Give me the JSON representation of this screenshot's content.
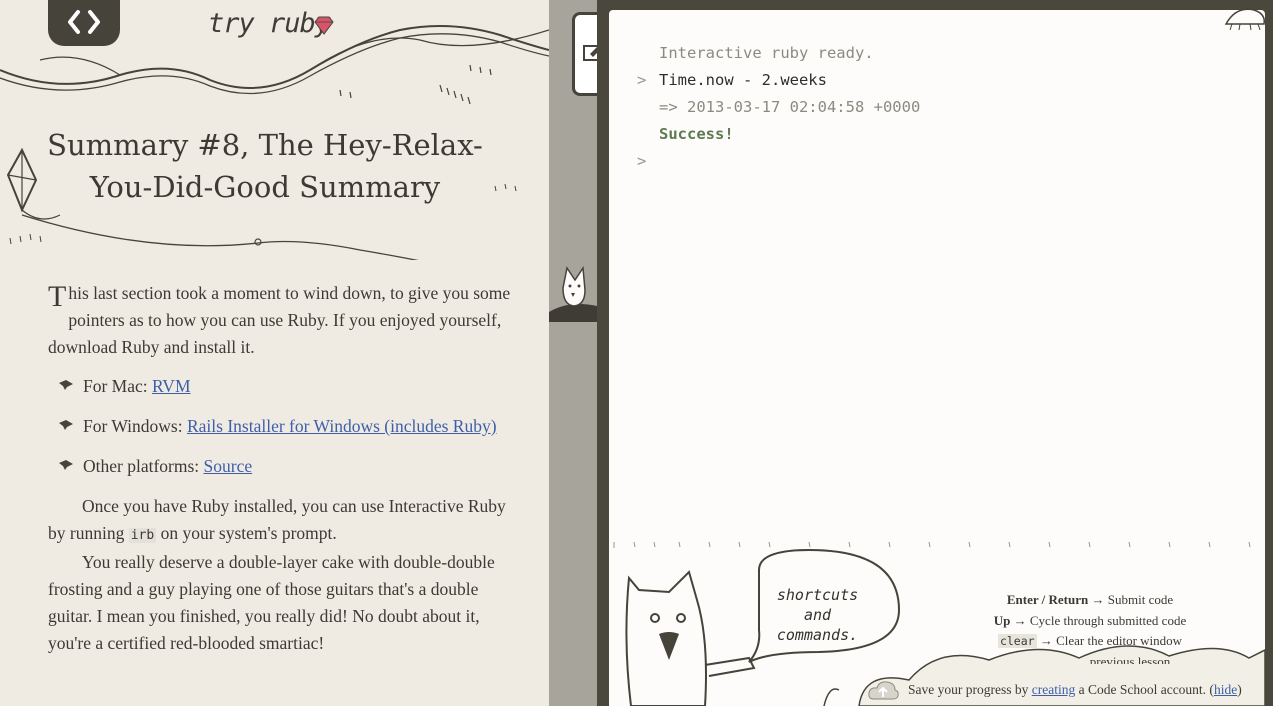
{
  "header": {
    "toggle_icon": "code-brackets-icon",
    "logo_text": "try ruby",
    "logo_icon": "ruby-gem-icon"
  },
  "lesson": {
    "title": "Summary #8, The Hey-Relax-You-Did-Good Summary",
    "intro_dropcap": "T",
    "intro_rest": "his last section took a moment to wind down, to give you some pointers as to how you can use Ruby. If you enjoyed yourself, download Ruby and install it.",
    "platforms": [
      {
        "label": "For Mac: ",
        "link": "RVM"
      },
      {
        "label": "For Windows: ",
        "link": "Rails Installer for Windows (includes Ruby)"
      },
      {
        "label": "Other platforms: ",
        "link": "Source"
      }
    ],
    "para2_pre": "Once you have Ruby installed, you can use Interactive Ruby by running ",
    "para2_code": "irb",
    "para2_post": " on your system's prompt.",
    "para3": "You really deserve a double-layer cake with double-double frosting and a guy playing one of those guitars that's a double guitar. I mean you finished, you really did! No doubt about it, you're a certified red-blooded smartiac!"
  },
  "console": {
    "ready": "Interactive ruby ready.",
    "prompt": ">",
    "input": "Time.now - 2.weeks",
    "output": "=> 2013-03-17 02:04:58 +0000",
    "success": "Success!",
    "edit_icon": "pencil-edit-icon"
  },
  "help": {
    "bubble": "shortcuts and commands.",
    "bubble_line1": "shortcuts",
    "bubble_line2": "and",
    "bubble_line3": "commands.",
    "shortcuts": [
      {
        "key": "Enter / Return",
        "text": " → Submit code"
      },
      {
        "key": "Up",
        "text": " → Cycle through submitted code"
      },
      {
        "key": "clear",
        "text": " → Clear the editor window"
      }
    ],
    "partial": "previous lesson"
  },
  "save": {
    "pre": "Save your progress by ",
    "link": "creating",
    "mid": " a Code School account. (",
    "hide": "hide",
    "post": ")"
  },
  "colors": {
    "frame": "#4a473d",
    "paper": "#efebe3",
    "link": "#3e5fa8",
    "success": "#5d7a51",
    "gem": "#d8546a"
  }
}
